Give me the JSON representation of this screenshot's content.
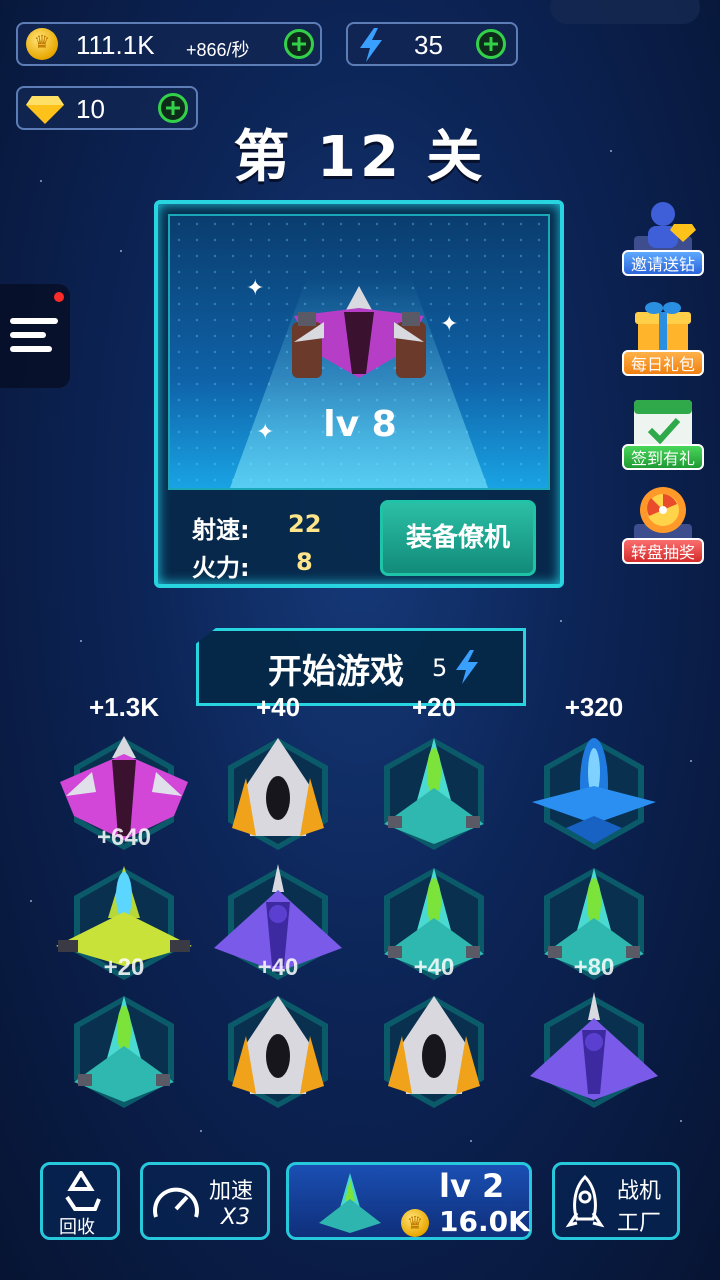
{
  "resources": {
    "coins": "111.1K",
    "coin_rate": "+866/秒",
    "energy": "35",
    "gems": "10"
  },
  "level_title": "第 12 关",
  "current_plane": {
    "level": "lv 8",
    "stats": [
      {
        "label": "射速:",
        "value": "22"
      },
      {
        "label": "火力:",
        "value": "8"
      }
    ],
    "equip_label": "装备僚机"
  },
  "side_buttons": [
    {
      "label": "邀请送钻",
      "icon": "invite-gem-icon"
    },
    {
      "label": "每日礼包",
      "icon": "gift-box-icon"
    },
    {
      "label": "签到有礼",
      "icon": "checkin-calendar-icon"
    },
    {
      "label": "转盘抽奖",
      "icon": "lucky-wheel-icon"
    }
  ],
  "start": {
    "label": "开始游戏",
    "cost": "5"
  },
  "slots": [
    {
      "income": "+1.3K",
      "popup": "+640",
      "ship": "purple-fighter"
    },
    {
      "income": "+40",
      "popup": "",
      "ship": "gold-fighter"
    },
    {
      "income": "+20",
      "popup": "",
      "ship": "teal-fighter"
    },
    {
      "income": "+320",
      "popup": "",
      "ship": "blue-fighter"
    },
    {
      "income": "",
      "popup": "+20",
      "ship": "lime-fighter"
    },
    {
      "income": "",
      "popup": "+40",
      "ship": "violet-bomber"
    },
    {
      "income": "",
      "popup": "+40",
      "ship": "teal-fighter"
    },
    {
      "income": "",
      "popup": "+80",
      "ship": "teal-fighter"
    },
    {
      "income": "",
      "popup": "",
      "ship": "teal-fighter"
    },
    {
      "income": "",
      "popup": "",
      "ship": "gold-fighter"
    },
    {
      "income": "",
      "popup": "",
      "ship": "gold-fighter"
    },
    {
      "income": "",
      "popup": "",
      "ship": "violet-bomber"
    }
  ],
  "bottom": {
    "recycle": "回收",
    "speed_label": "加速",
    "speed_mult": "X3",
    "buy_level": "lv 2",
    "buy_cost": "16.0K",
    "factory_line1": "战机",
    "factory_line2": "工厂"
  },
  "colors": {
    "accent_cyan": "#27d4e0",
    "plus_green": "#33d04a",
    "stat_yellow": "#ffe58a",
    "background": "#0c2456"
  }
}
